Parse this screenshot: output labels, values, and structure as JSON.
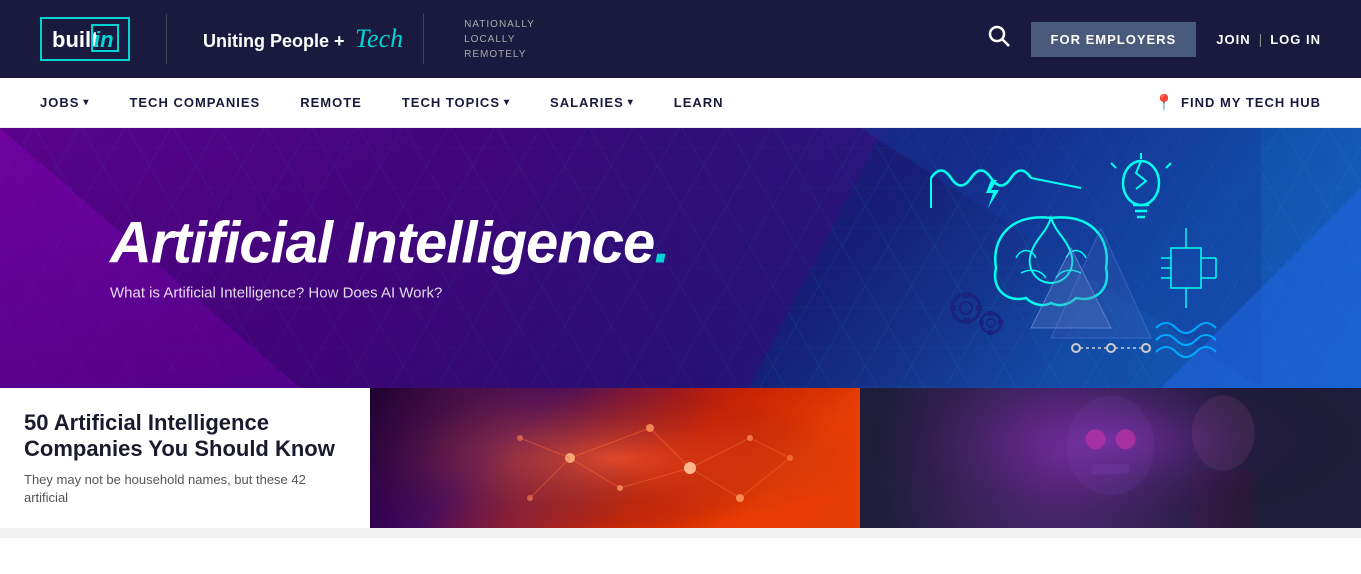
{
  "topNav": {
    "logo": "built·in",
    "logoAccent": "in",
    "tagline_prefix": "Uniting People +",
    "tagline_tech": "Tech",
    "nationally": "NATIONALLY\nLOCALLY\nREMOTELY",
    "forEmployers": "FOR EMPLOYERS",
    "join": "JOIN",
    "login": "LOG IN"
  },
  "secondaryNav": {
    "items": [
      {
        "label": "JOBS",
        "hasDropdown": true
      },
      {
        "label": "TECH COMPANIES",
        "hasDropdown": false
      },
      {
        "label": "REMOTE",
        "hasDropdown": false
      },
      {
        "label": "TECH TOPICS",
        "hasDropdown": true
      },
      {
        "label": "SALARIES",
        "hasDropdown": true
      },
      {
        "label": "LEARN",
        "hasDropdown": false
      }
    ],
    "findHub": "FIND MY TECH HUB"
  },
  "hero": {
    "title": "Artificial Intelligence",
    "dot": ".",
    "subtitle": "What is Artificial Intelligence? How Does AI Work?"
  },
  "articles": [
    {
      "title": "50 Artificial Intelligence Companies You Should Know",
      "description": "They may not be household names, but these 42 artificial"
    }
  ]
}
